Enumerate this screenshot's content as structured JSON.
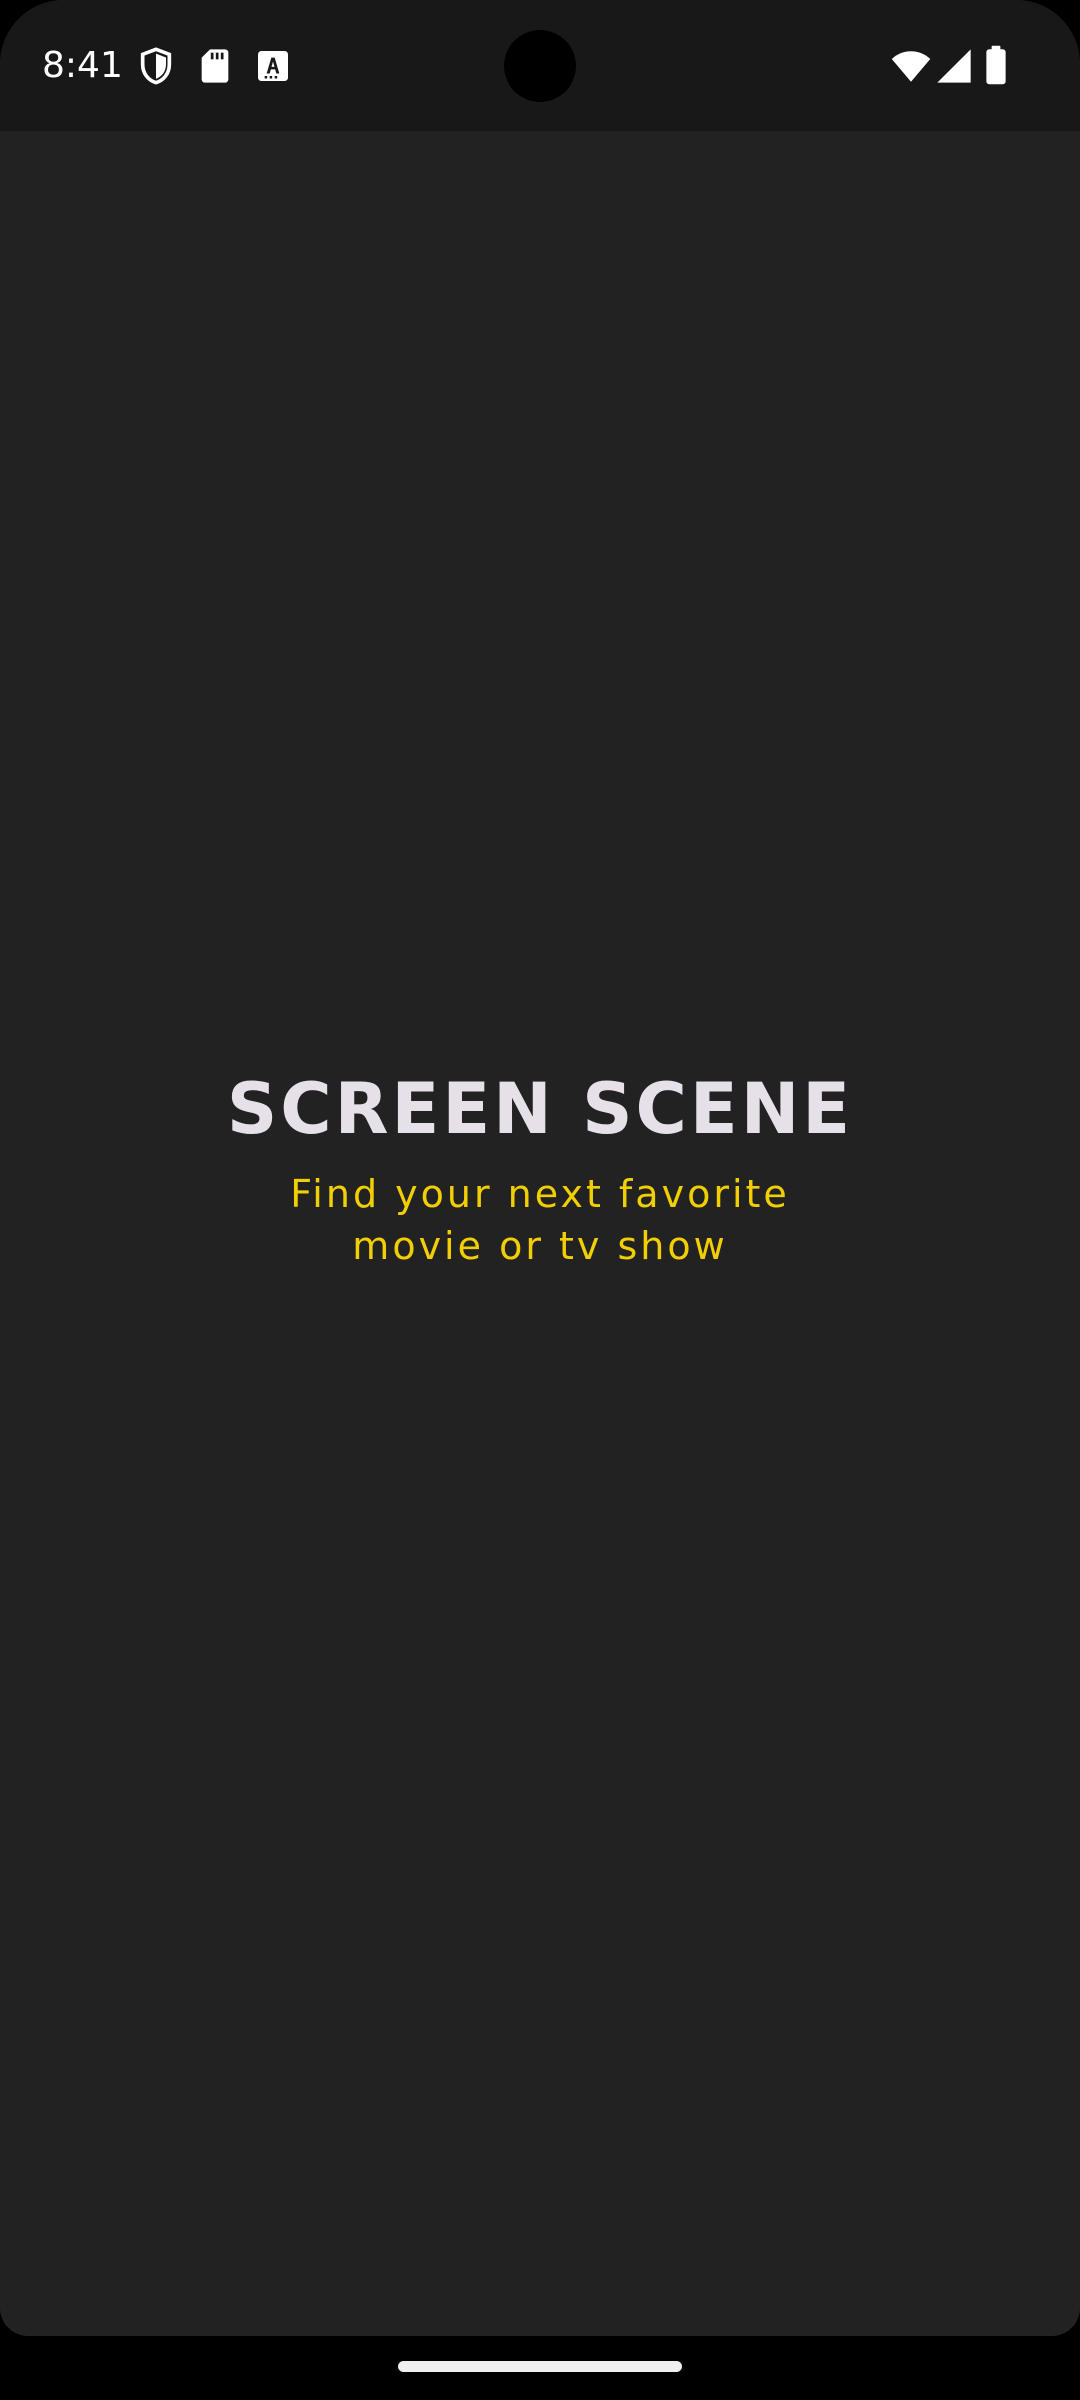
{
  "status_bar": {
    "time": "8:41",
    "left_icons": [
      "shield-icon",
      "sd-card-icon",
      "text-box-icon"
    ],
    "right_icons": [
      "wifi-icon",
      "cell-signal-icon",
      "battery-icon"
    ]
  },
  "splash": {
    "title": "SCREEN SCENE",
    "tagline": "Find your next favorite movie or tv show"
  },
  "colors": {
    "background": "#222222",
    "status_bar": "#181818",
    "title": "#e6e1e8",
    "accent": "#f2cf00"
  }
}
